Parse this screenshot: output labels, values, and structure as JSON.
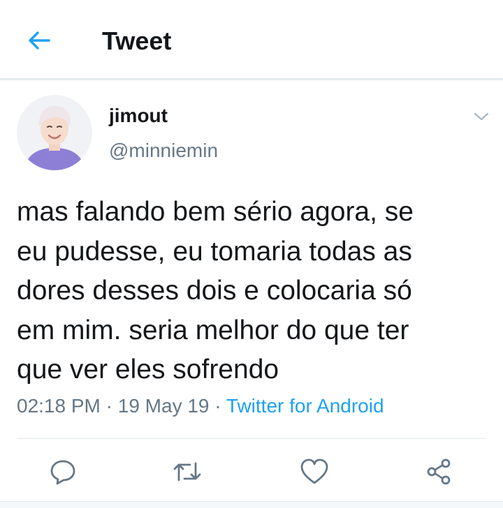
{
  "header": {
    "back_icon": "arrow-left-icon",
    "title": "Tweet"
  },
  "tweet": {
    "author": {
      "display_name": "jimout",
      "handle": "@minniemin"
    },
    "text": "mas falando bem sério agora, se\neu pudesse, eu tomaria todas as\ndores desses dois e colocaria só\nem mim. seria melhor do que ter\nque ver eles sofrendo",
    "time": "02:18 PM",
    "date": "19 May 19",
    "separator": " · ",
    "source": "Twitter for Android"
  },
  "actions": [
    {
      "icon": "reply-icon"
    },
    {
      "icon": "retweet-icon"
    },
    {
      "icon": "like-icon"
    },
    {
      "icon": "share-icon"
    }
  ],
  "colors": {
    "accent": "#1da1f2",
    "secondary_text": "#657786",
    "primary_text": "#14171a",
    "divider": "#e1e8ed"
  }
}
